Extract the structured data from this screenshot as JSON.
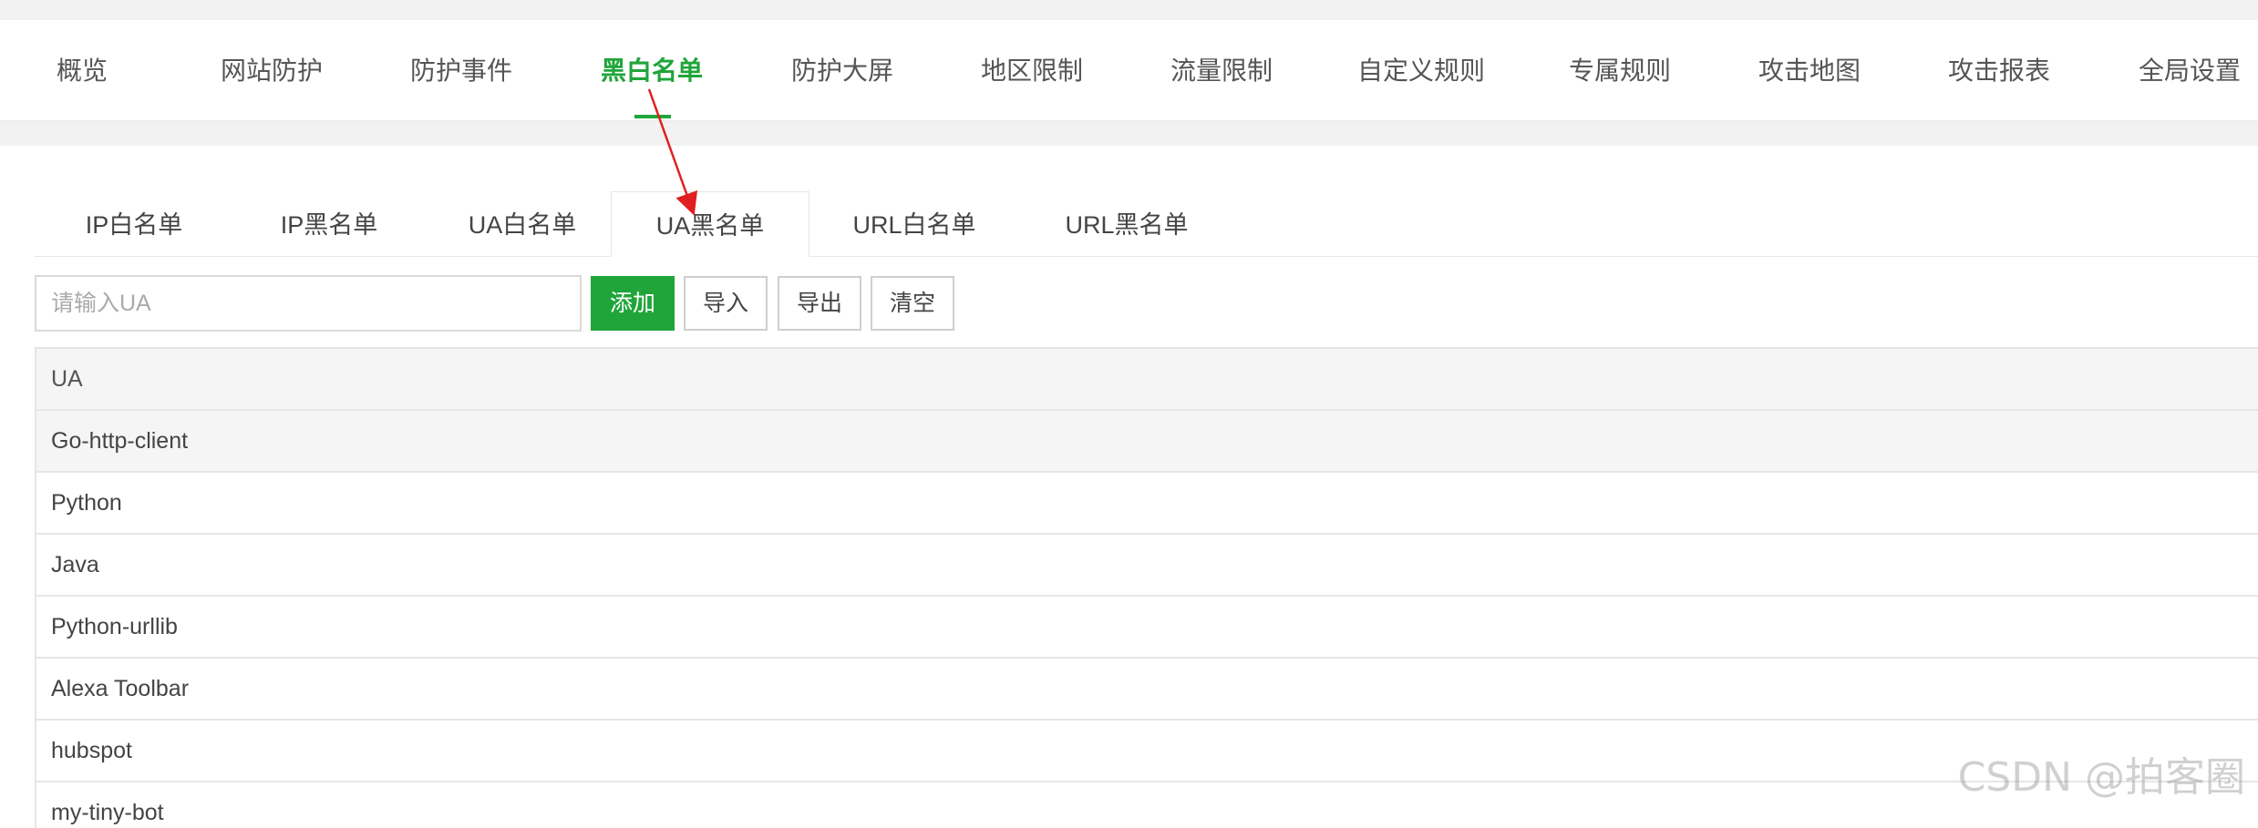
{
  "top_nav": {
    "items": [
      {
        "label": "概览"
      },
      {
        "label": "网站防护"
      },
      {
        "label": "防护事件"
      },
      {
        "label": "黑白名单"
      },
      {
        "label": "防护大屏"
      },
      {
        "label": "地区限制"
      },
      {
        "label": "流量限制"
      },
      {
        "label": "自定义规则"
      },
      {
        "label": "专属规则"
      },
      {
        "label": "攻击地图"
      },
      {
        "label": "攻击报表"
      },
      {
        "label": "全局设置"
      }
    ],
    "active": "黑白名单"
  },
  "tabs": {
    "items": [
      {
        "label": "IP白名单"
      },
      {
        "label": "IP黑名单"
      },
      {
        "label": "UA白名单"
      },
      {
        "label": "UA黑名单"
      },
      {
        "label": "URL白名单"
      },
      {
        "label": "URL黑名单"
      }
    ],
    "active": "UA黑名单"
  },
  "toolbar": {
    "input_placeholder": "请输入UA",
    "input_value": "",
    "add_label": "添加",
    "import_label": "导入",
    "export_label": "导出",
    "clear_label": "清空"
  },
  "table": {
    "header": "UA",
    "rows": [
      "Go-http-client",
      "Python",
      "Java",
      "Python-urllib",
      "Alexa Toolbar",
      "hubspot",
      "my-tiny-bot"
    ]
  },
  "colors": {
    "accent": "#20a53a",
    "annotation_arrow": "#e02020"
  },
  "watermark": "CSDN @拍客圈"
}
